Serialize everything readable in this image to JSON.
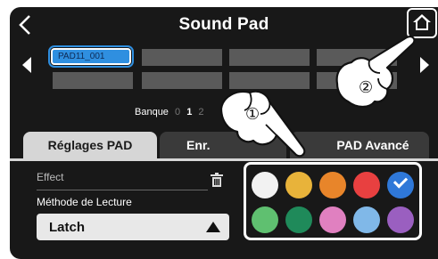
{
  "header": {
    "title": "Sound Pad",
    "back_icon": "chevron-left-icon",
    "home_icon": "home-icon"
  },
  "pads": {
    "selected_label": "PAD11_001",
    "selected_color": "#2f8fe0",
    "empty_color": "#5a5a5a"
  },
  "bank": {
    "label": "Banque",
    "numbers": [
      "0",
      "1",
      "2"
    ],
    "active": "1"
  },
  "tabs": [
    {
      "label": "Réglages PAD",
      "active": true
    },
    {
      "label": "Enr.",
      "active": false
    },
    {
      "label": "PAD Avancé",
      "active": false
    }
  ],
  "settings": {
    "effect_label": "Effect",
    "method_label": "Méthode de Lecture",
    "method_value": "Latch"
  },
  "palette": {
    "colors": [
      "#f2f2f2",
      "#e8b33a",
      "#e8852a",
      "#e84040",
      "#2f78d8",
      "#5fc070",
      "#1f8a5a",
      "#e080c0",
      "#80b8e8",
      "#9a5fc0"
    ],
    "selected": "#2f78d8"
  },
  "callouts": [
    "①",
    "②"
  ]
}
